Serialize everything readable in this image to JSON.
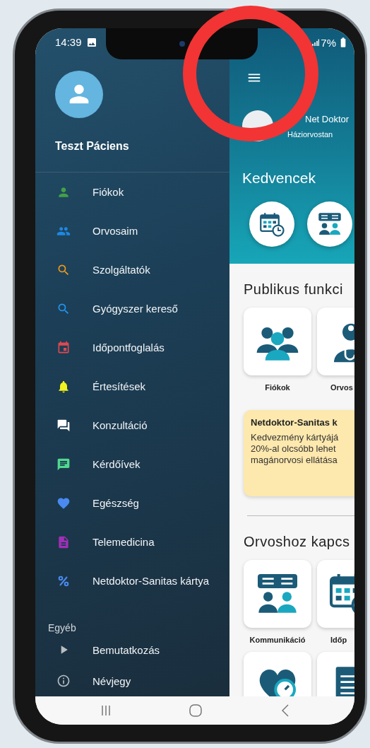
{
  "status_bar": {
    "time": "14:39",
    "battery": "7%"
  },
  "drawer": {
    "user_name": "Teszt Páciens",
    "items": [
      {
        "kind": "person",
        "label": "Fiókok",
        "color": "#43a047"
      },
      {
        "kind": "people",
        "label": "Orvosaim",
        "color": "#1e88e5"
      },
      {
        "kind": "search",
        "label": "Szolgáltatók",
        "color": "#f09a1a"
      },
      {
        "kind": "search",
        "label": "Gyógyszer kereső",
        "color": "#2196f3"
      },
      {
        "kind": "calendar",
        "label": "Időpontfoglalás",
        "color": "#e04850"
      },
      {
        "kind": "bell",
        "label": "Értesítések",
        "color": "#f2f21e"
      },
      {
        "kind": "forum",
        "label": "Konzultáció",
        "color": "#ffffff"
      },
      {
        "kind": "chat",
        "label": "Kérdőívek",
        "color": "#50d890"
      },
      {
        "kind": "heart",
        "label": "Egészség",
        "color": "#4a8af0"
      },
      {
        "kind": "document",
        "label": "Telemedicina",
        "color": "#a030b8"
      },
      {
        "kind": "percent",
        "label": "Netdoktor-Sanitas kártya",
        "color": "#4a8af0"
      }
    ],
    "section": {
      "title": "Egyéb",
      "items": [
        {
          "kind": "play",
          "label": "Bemutatkozás"
        },
        {
          "kind": "info",
          "label": "Névjegy"
        }
      ]
    }
  },
  "header": {
    "doctor": {
      "name": "Net Doktor",
      "role": "Háziorvostan"
    },
    "favorites_title": "Kedvencek",
    "favorites": [
      {
        "kind": "calendar"
      },
      {
        "kind": "chat"
      }
    ]
  },
  "public_section": {
    "title": "Publikus funkci",
    "tiles": [
      {
        "kind": "group",
        "label": "Fiókok"
      },
      {
        "kind": "doctor",
        "label": "Orvos"
      }
    ]
  },
  "promo_card": {
    "title": "Netdoktor-Sanitas k",
    "lines": [
      "Kedvezmény kártyájá",
      "20%-al olcsóbb lehet",
      "magánorvosi ellátása"
    ]
  },
  "doctor_section": {
    "title": "Orvoshoz kapcs",
    "tiles": [
      {
        "kind": "chat",
        "label": "Kommunikáció"
      },
      {
        "kind": "calendar",
        "label": "Időp"
      },
      {
        "kind": "heart"
      },
      {
        "kind": "document"
      }
    ]
  }
}
